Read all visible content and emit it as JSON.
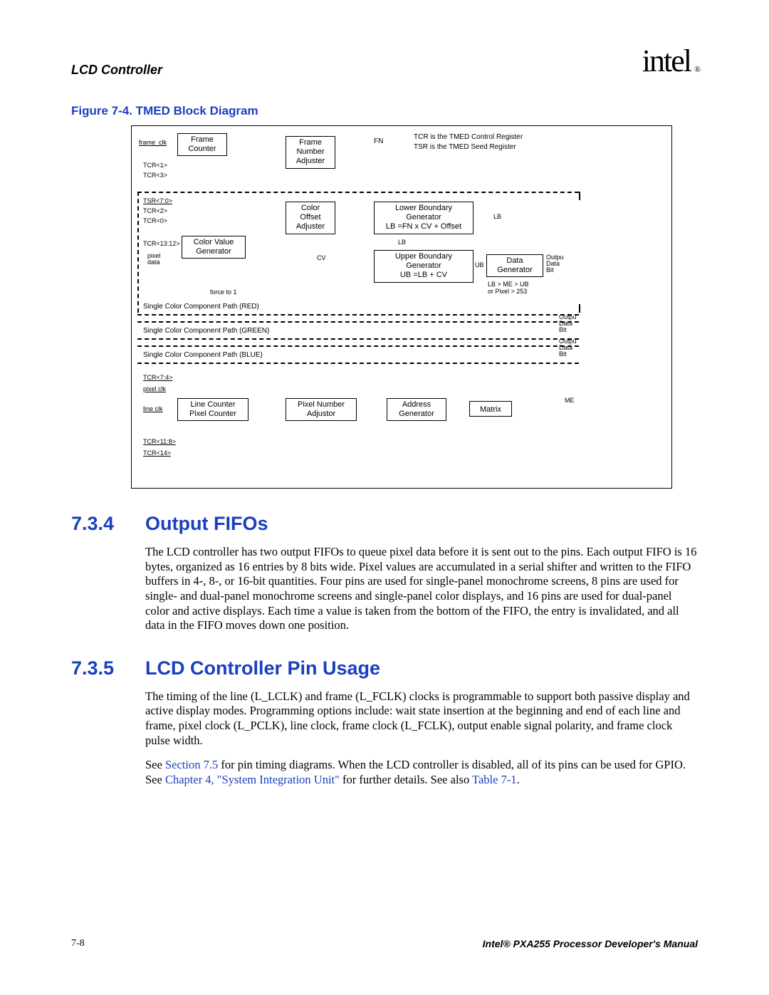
{
  "header": {
    "left": "LCD Controller",
    "brand": "intel",
    "reg": "®"
  },
  "figure": {
    "title": "Figure 7-4.  TMED Block Diagram",
    "note1": "TCR is the TMED Control Register",
    "note2": "TSR is the TMED Seed Register",
    "frame_clk": "frame_clk",
    "frame_counter": "Frame\nCounter",
    "frame_number_adjuster": "Frame\nNumber\nAdjuster",
    "fn": "FN",
    "tcr1": "TCR<1>",
    "tcr3": "TCR<3>",
    "tsr70": "TSR<7:0>",
    "tcr2": "TCR<2>",
    "tcr0": "TCR<0>",
    "color_offset_adjuster": "Color\nOffset\nAdjuster",
    "lower_boundary": "Lower Boundary\nGenerator\nLB =FN x CV + Offset",
    "lb": "LB",
    "tcr1312": "TCR<13:12>",
    "color_value_generator": "Color Value\nGenerator",
    "pixel_data": "pixel\ndata",
    "cv": "CV",
    "upper_boundary": "Upper Boundary\nGenerator\nUB =LB + CV",
    "ub": "UB",
    "data_generator": "Data\nGenerator",
    "outpu_data_bit": "Outpu\nData\nBit",
    "lb_me_ub": "LB > ME > UB\nor Pixel > 253",
    "force_to_1": "force to 1",
    "red_path": "Single Color Component Path (RED)",
    "green_path": "Single Color Component Path (GREEN)",
    "blue_path": "Single Color Component Path (BLUE)",
    "tcr74": "TCR<7:4>",
    "pixel_clk": "pixel clk",
    "line_clk": "line clk",
    "line_pixel_counter": "Line Counter\nPixel Counter",
    "pixel_number_adjustor": "Pixel Number\nAdjustor",
    "address_generator": "Address\nGenerator",
    "matrix": "Matrix",
    "me": "ME",
    "tcr118": "TCR<11:8>",
    "tcr14": "TCR<14>"
  },
  "section1": {
    "num": "7.3.4",
    "title": "Output FIFOs",
    "para": "The LCD controller has two output FIFOs to queue pixel data before it is sent out to the pins. Each output FIFO is 16 bytes, organized as 16 entries by 8 bits wide. Pixel values are accumulated in a serial shifter and written to the FIFO buffers in 4-, 8-, or 16-bit quantities. Four pins are used for single-panel monochrome screens, 8 pins are used for single- and dual-panel monochrome screens and single-panel color displays, and 16 pins are used for dual-panel color and active displays. Each time a value is taken from the bottom of the FIFO, the entry is invalidated, and all data in the FIFO moves down one position."
  },
  "section2": {
    "num": "7.3.5",
    "title": "LCD Controller Pin Usage",
    "para1": "The timing of the line (L_LCLK) and frame (L_FCLK) clocks is programmable to support both passive display and active display modes. Programming options include: wait state insertion at the beginning and end of each line and frame, pixel clock (L_PCLK), line clock, frame clock (L_FCLK), output enable signal polarity, and frame clock pulse width.",
    "para2a": "See ",
    "para2_link1": "Section 7.5",
    "para2b": " for pin timing diagrams. When the LCD controller is disabled, all of its pins can be used for GPIO. See ",
    "para2_link2": "Chapter 4, \"System Integration Unit\"",
    "para2c": " for further details. See also ",
    "para2_link3": "Table 7-1",
    "para2d": "."
  },
  "footer": {
    "pagenum": "7-8",
    "manual": "Intel® PXA255 Processor Developer's Manual"
  }
}
